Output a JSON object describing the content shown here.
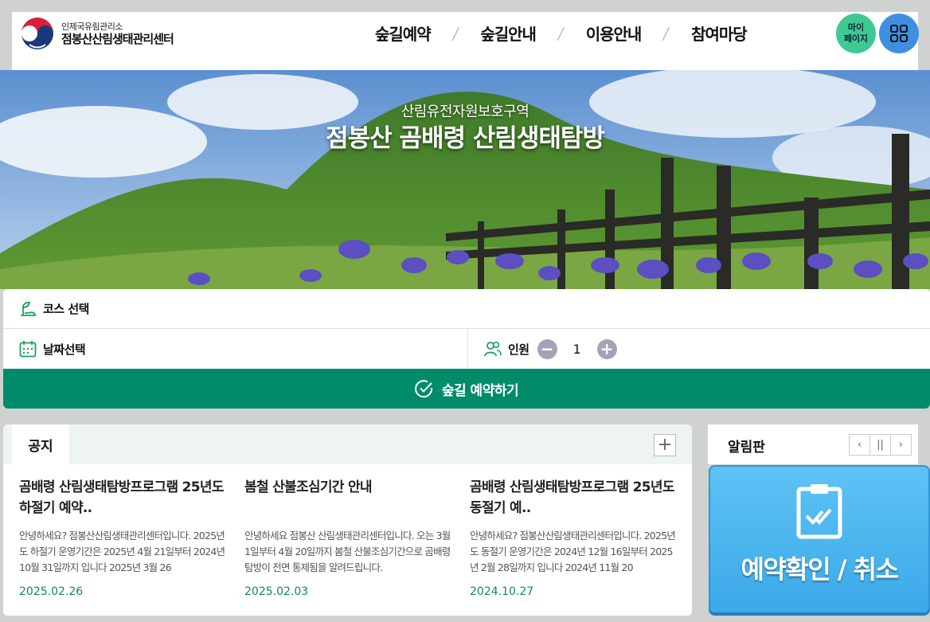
{
  "header": {
    "org_sub": "인제국유림관리소",
    "org_main": "점봉산산림생태관리센터",
    "nav": [
      "숲길예약",
      "숲길안내",
      "이용안내",
      "참여마당"
    ],
    "mypage_line1": "마이",
    "mypage_line2": "페이지",
    "allmenu_icon": "grid-icon"
  },
  "hero": {
    "subtitle": "산림유전자원보호구역",
    "title": "점봉산 곰배령 산림생태탐방"
  },
  "booking": {
    "course_label": "코스 선택",
    "date_label": "날짜선택",
    "people_label": "인원",
    "people_count": "1",
    "minus": "−",
    "plus": "+",
    "submit_label": "숲길 예약하기",
    "accent": "#008c6b"
  },
  "notice": {
    "tab": "공지",
    "more": "+",
    "items": [
      {
        "title": "곰배령 산림생태탐방프로그램 25년도 하절기 예약..",
        "body": "안녕하세요? 점봉산산림생태관리센터입니다. 2025년도 하절기 운영기간은 2025년 4월 21일부터 2024년 10월 31일까지 입니다 2025년 3월 26",
        "date": "2025.02.26"
      },
      {
        "title": "봄철 산불조심기간 안내",
        "body": "안녕하세요 점봉산 산림생태관리센터입니다. 오는 3월 1일부터 4월 20일까지 봄철 산불조심기간으로 곰배령 탐방이 전면 통제됨을 알려드립니다.",
        "date": "2025.02.03"
      },
      {
        "title": "곰배령 산림생태탐방프로그램 25년도 동절기 예..",
        "body": "안녕하세요? 점봉산산림생태관리센터입니다. 2025년도 동절기 운영기간은 2024년 12월 16일부터 2025년 2월 28일까지 입니다 2024년 11월 20",
        "date": "2024.10.27"
      }
    ]
  },
  "alarm": {
    "title": "알림판",
    "prev": "‹",
    "pause": "||",
    "next": "›"
  },
  "confirm": {
    "label": "예약확인 / 취소",
    "color": "#4cb5ef"
  }
}
